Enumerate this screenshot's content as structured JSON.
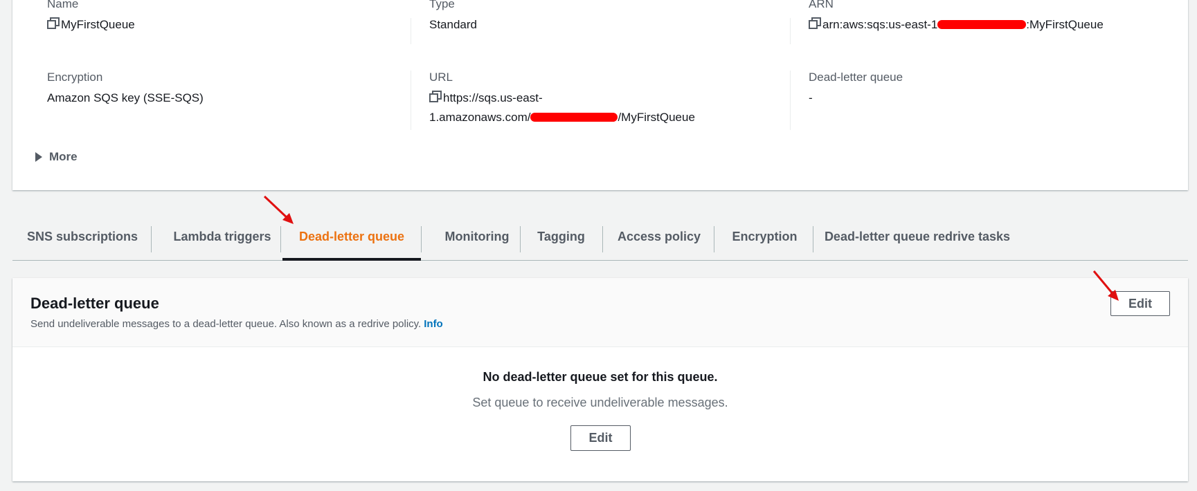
{
  "details": {
    "name": {
      "label": "Name",
      "value": "MyFirstQueue"
    },
    "type": {
      "label": "Type",
      "value": "Standard"
    },
    "arn": {
      "label": "ARN",
      "prefix": "arn:aws:sqs:us-east-1",
      "suffix": ":MyFirstQueue"
    },
    "encryption": {
      "label": "Encryption",
      "value": "Amazon SQS key (SSE-SQS)"
    },
    "url": {
      "label": "URL",
      "line1": "https://sqs.us-east-",
      "line2_prefix": "1.amazonaws.com/",
      "line2_suffix": "/MyFirstQueue"
    },
    "dlq": {
      "label": "Dead-letter queue",
      "value": "-"
    },
    "more_label": "More"
  },
  "tabs": [
    {
      "label": "SNS subscriptions"
    },
    {
      "label": "Lambda triggers"
    },
    {
      "label": "Dead-letter queue",
      "active": true
    },
    {
      "label": "Monitoring"
    },
    {
      "label": "Tagging"
    },
    {
      "label": "Access policy"
    },
    {
      "label": "Encryption"
    },
    {
      "label": "Dead-letter queue redrive tasks"
    }
  ],
  "panel": {
    "title": "Dead-letter queue",
    "description": "Send undeliverable messages to a dead-letter queue. Also known as a redrive policy.",
    "info_link": "Info",
    "edit_label": "Edit",
    "empty_title": "No dead-letter queue set for this queue.",
    "empty_description": "Set queue to receive undeliverable messages.",
    "empty_edit_label": "Edit"
  },
  "icons": {
    "copy": "copy-icon",
    "expand": "caret-right-icon",
    "annotation": "red-arrow-icon"
  },
  "colors": {
    "accent": "#ec7211",
    "link": "#0073bb",
    "redaction": "#ff0000",
    "annotation": "#e01010"
  }
}
